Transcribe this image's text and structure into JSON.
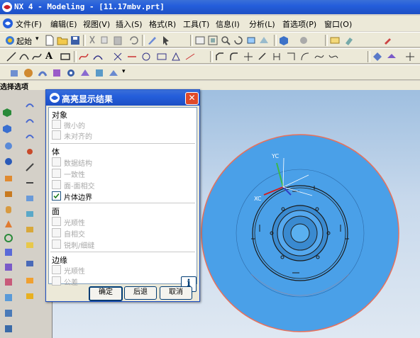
{
  "window": {
    "title": "NX 4 - Modeling - [11.17mbv.prt]"
  },
  "menu": [
    "文件(F)",
    "编辑(E)",
    "视图(V)",
    "插入(S)",
    "格式(R)",
    "工具(T)",
    "信息(I)",
    "分析(L)",
    "首选项(P)",
    "窗口(O)"
  ],
  "toolbar": {
    "start_label": "起始"
  },
  "selection_panel": {
    "label": "选择选项"
  },
  "dialog": {
    "title": "高亮显示结果",
    "groups": [
      {
        "label": "对象",
        "options": [
          {
            "label": "微小的",
            "checked": false
          },
          {
            "label": "未对齐的",
            "checked": false
          }
        ]
      },
      {
        "label": "体",
        "options": [
          {
            "label": "数据结构",
            "checked": false
          },
          {
            "label": "一致性",
            "checked": false
          },
          {
            "label": "面-面相交",
            "checked": false
          },
          {
            "label": "片体边界",
            "checked": true
          }
        ]
      },
      {
        "label": "面",
        "options": [
          {
            "label": "光顺性",
            "checked": false
          },
          {
            "label": "自相交",
            "checked": false
          },
          {
            "label": "锐刺/细缝",
            "checked": false
          }
        ]
      },
      {
        "label": "边缘",
        "options": [
          {
            "label": "光顺性",
            "checked": false
          },
          {
            "label": "公差",
            "checked": false
          }
        ]
      }
    ],
    "info_icon": "info-icon",
    "buttons": {
      "ok": "确定",
      "back": "后退",
      "cancel": "取消"
    }
  },
  "viewport": {
    "axis_labels": {
      "yc": "YC",
      "xc": "XC"
    },
    "colors": {
      "disc": "#4aa0e8",
      "outline": "#e8705a"
    }
  }
}
